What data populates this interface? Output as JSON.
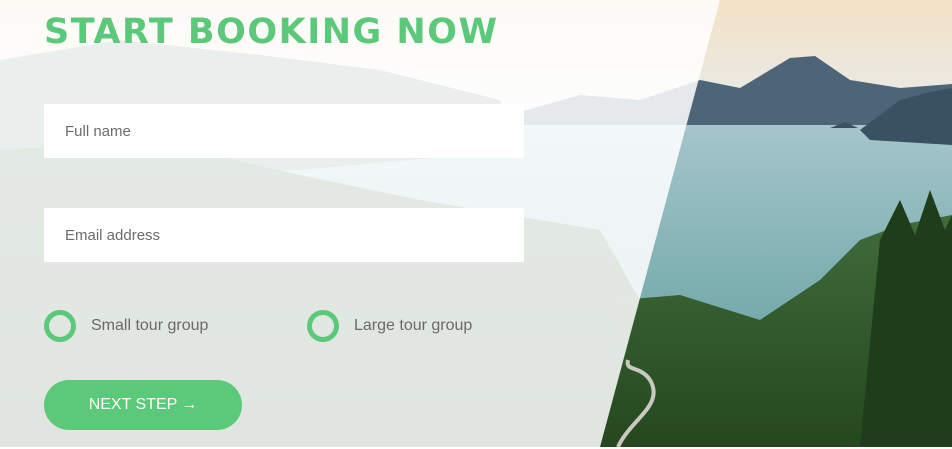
{
  "title": "START BOOKING NOW",
  "form": {
    "full_name_placeholder": "Full name",
    "email_placeholder": "Email address"
  },
  "options": [
    {
      "label": "Small tour group"
    },
    {
      "label": "Large tour group"
    }
  ],
  "next_button": {
    "label": "NEXT STEP",
    "arrow": "→"
  },
  "colors": {
    "accent": "#5cc97a"
  }
}
